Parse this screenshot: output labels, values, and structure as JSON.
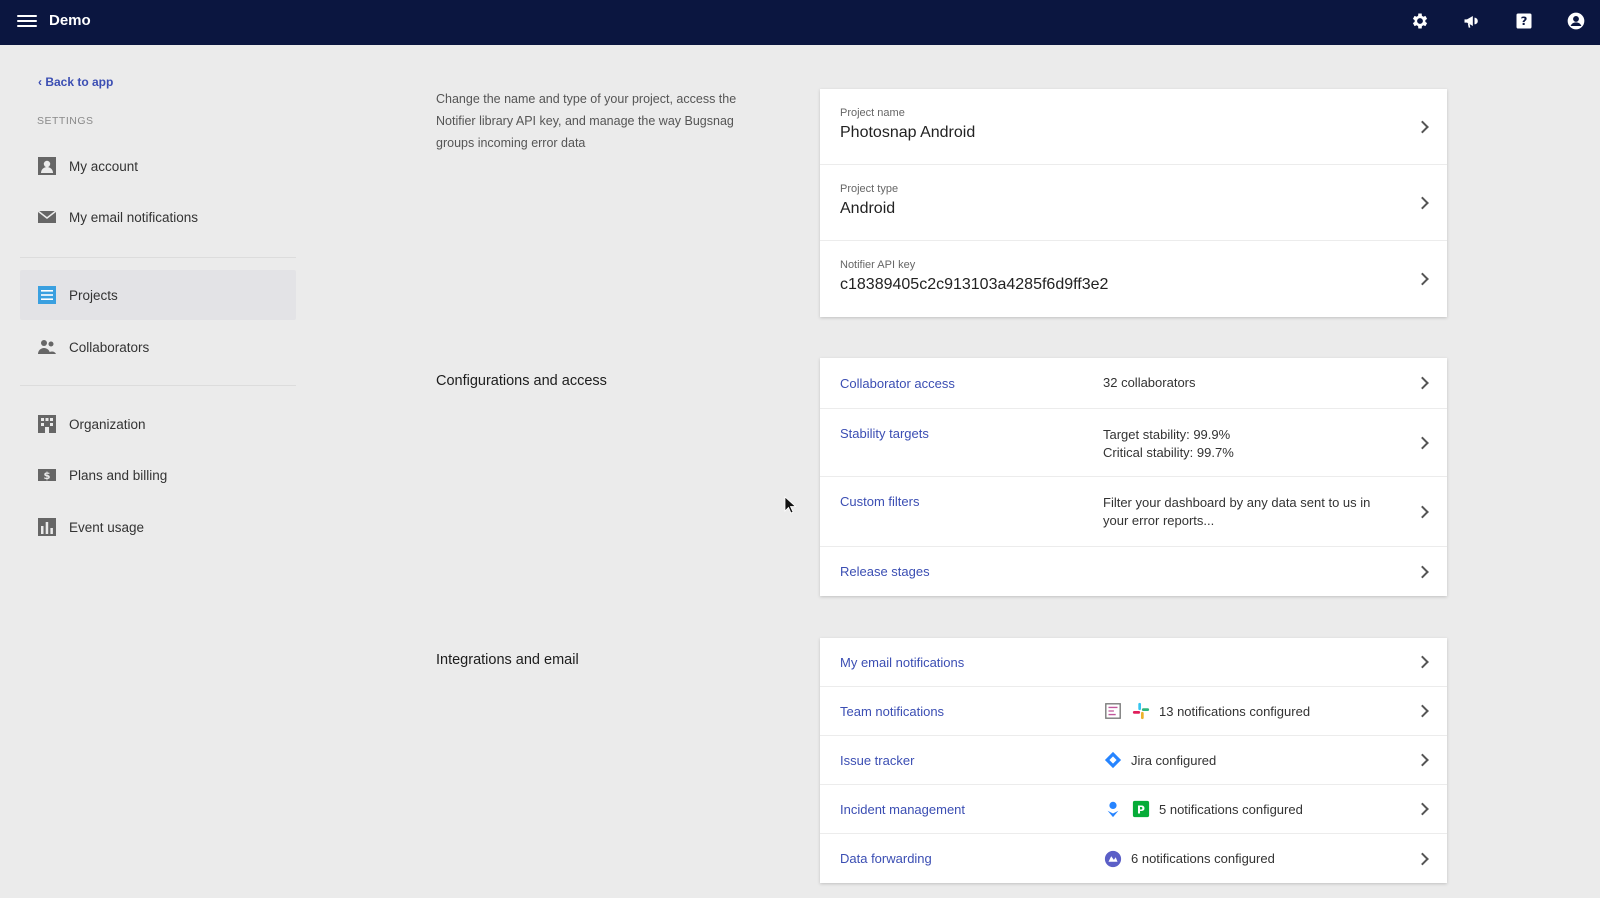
{
  "topbar": {
    "app_name": "Demo",
    "icons": [
      "settings-icon",
      "announcement-icon",
      "help-icon",
      "account-icon"
    ]
  },
  "sidebar": {
    "back_link": "‹ Back to app",
    "heading": "SETTINGS",
    "items": [
      {
        "label": "My account",
        "icon": "person-card-icon",
        "active": false
      },
      {
        "label": "My email notifications",
        "icon": "envelope-icon",
        "active": false
      },
      {
        "label": "Projects",
        "icon": "projects-list-icon",
        "active": true
      },
      {
        "label": "Collaborators",
        "icon": "people-icon",
        "active": false
      },
      {
        "label": "Organization",
        "icon": "building-icon",
        "active": false
      },
      {
        "label": "Plans and billing",
        "icon": "dollar-bill-icon",
        "active": false
      },
      {
        "label": "Event usage",
        "icon": "bar-chart-icon",
        "active": false
      }
    ]
  },
  "project_section": {
    "description": "Change the name and type of your project, access the Notifier library API key, and manage the way Bugsnag groups incoming error data",
    "fields": [
      {
        "label": "Project name",
        "value": "Photosnap Android"
      },
      {
        "label": "Project type",
        "value": "Android"
      },
      {
        "label": "Notifier API key",
        "value": "c18389405c2c913103a4285f6d9ff3e2"
      }
    ]
  },
  "config_section": {
    "title": "Configurations and access",
    "rows": [
      {
        "label": "Collaborator access",
        "value": "32 collaborators"
      },
      {
        "label": "Stability targets",
        "value": "Target stability: 99.9%",
        "value2": "Critical stability: 99.7%"
      },
      {
        "label": "Custom filters",
        "value": "Filter your dashboard by any data sent to us in your error reports..."
      },
      {
        "label": "Release stages",
        "value": ""
      }
    ]
  },
  "integrations_section": {
    "title": "Integrations and email",
    "rows": [
      {
        "label": "My email notifications",
        "value": ""
      },
      {
        "label": "Team notifications",
        "value": "13 notifications configured"
      },
      {
        "label": "Issue tracker",
        "value": "Jira configured"
      },
      {
        "label": "Incident management",
        "value": "5 notifications configured"
      },
      {
        "label": "Data forwarding",
        "value": "6 notifications configured"
      }
    ]
  },
  "colors": {
    "topbar": "#0b1640",
    "link": "#3b4eb3",
    "background": "#ebebeb"
  }
}
